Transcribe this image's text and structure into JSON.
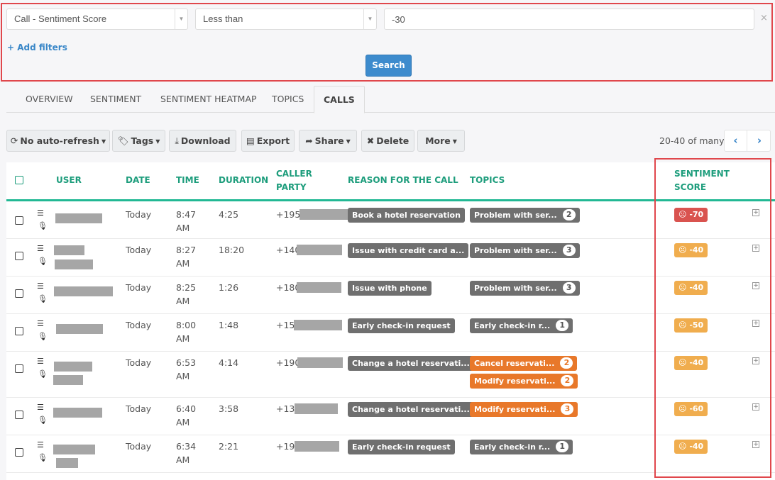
{
  "filters": {
    "field": "Call - Sentiment Score",
    "operator": "Less than",
    "value": "-30",
    "add_filters_label": "Add filters",
    "search_label": "Search"
  },
  "tabs": [
    {
      "label": "OVERVIEW",
      "active": false
    },
    {
      "label": "SENTIMENT",
      "active": false
    },
    {
      "label": "SENTIMENT HEATMAP",
      "active": false
    },
    {
      "label": "TOPICS",
      "active": false
    },
    {
      "label": "CALLS",
      "active": true
    }
  ],
  "toolbar": {
    "auto_refresh": "No auto-refresh",
    "tags": "Tags",
    "download": "Download",
    "export": "Export",
    "share": "Share",
    "delete": "Delete",
    "more": "More"
  },
  "pager": {
    "text": "20-40 of many",
    "prev": "‹",
    "next": "›"
  },
  "table": {
    "headers": {
      "user": "USER",
      "date": "DATE",
      "time": "TIME",
      "duration": "DURATION",
      "caller_line1": "CALLER",
      "caller_line2": "PARTY",
      "reason": "REASON FOR THE CALL",
      "topics": "TOPICS",
      "score_line1": "SENTIMENT",
      "score_line2": "SCORE"
    },
    "rows": [
      {
        "date": "Today",
        "time_1": "8:47",
        "time_2": "AM",
        "duration": "4:25",
        "caller": "+1954",
        "reason": "Book a hotel reservation",
        "topics": [
          {
            "label": "Problem with ser...",
            "count": "2",
            "color": "gray"
          }
        ],
        "score": "-70",
        "score_color": "#d9534f"
      },
      {
        "date": "Today",
        "time_1": "8:27",
        "time_2": "AM",
        "duration": "18:20",
        "caller": "+1404",
        "reason": "Issue with credit card a...",
        "topics": [
          {
            "label": "Problem with ser...",
            "count": "3",
            "color": "gray"
          }
        ],
        "score": "-40",
        "score_color": "#f0ad4e"
      },
      {
        "date": "Today",
        "time_1": "8:25",
        "time_2": "AM",
        "duration": "1:26",
        "caller": "+180",
        "reason": "Issue with phone",
        "topics": [
          {
            "label": "Problem with ser...",
            "count": "3",
            "color": "gray"
          }
        ],
        "score": "-40",
        "score_color": "#f0ad4e"
      },
      {
        "date": "Today",
        "time_1": "8:00",
        "time_2": "AM",
        "duration": "1:48",
        "caller": "+157",
        "reason": "Early check-in request",
        "topics": [
          {
            "label": "Early check-in r...",
            "count": "1",
            "color": "gray"
          }
        ],
        "score": "-50",
        "score_color": "#f0ad4e"
      },
      {
        "date": "Today",
        "time_1": "6:53",
        "time_2": "AM",
        "duration": "4:14",
        "caller": "+190",
        "reason": "Change a hotel reservati...",
        "topics": [
          {
            "label": "Cancel reservati...",
            "count": "2",
            "color": "orange"
          },
          {
            "label": "Modify reservati...",
            "count": "2",
            "color": "orange"
          }
        ],
        "score": "-40",
        "score_color": "#f0ad4e"
      },
      {
        "date": "Today",
        "time_1": "6:40",
        "time_2": "AM",
        "duration": "3:58",
        "caller": "+130",
        "reason": "Change a hotel reservati...",
        "topics": [
          {
            "label": "Modify reservati...",
            "count": "3",
            "color": "orange"
          }
        ],
        "score": "-60",
        "score_color": "#f0ad4e"
      },
      {
        "date": "Today",
        "time_1": "6:34",
        "time_2": "AM",
        "duration": "2:21",
        "caller": "+194",
        "reason": "Early check-in request",
        "topics": [
          {
            "label": "Early check-in r...",
            "count": "1",
            "color": "gray"
          }
        ],
        "score": "-40",
        "score_color": "#f0ad4e"
      }
    ]
  },
  "colors": {
    "accent": "#1d9d7c",
    "primary": "#3d8bcd",
    "danger": "#d9534f",
    "warning": "#f0ad4e",
    "topic_orange": "#e8782a",
    "highlight": "#e0474c"
  }
}
